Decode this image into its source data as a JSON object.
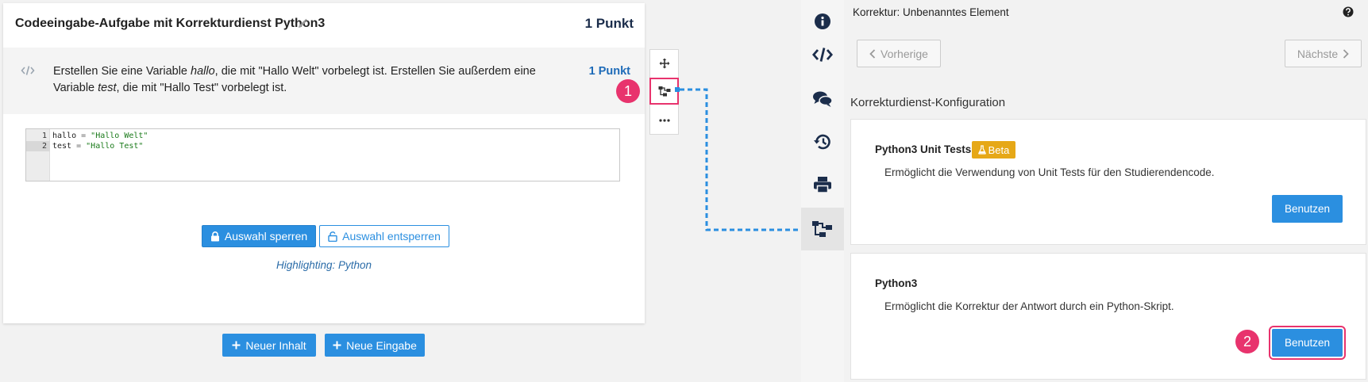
{
  "task": {
    "title": "Codeeingabe-Aufgabe mit Korrekturdienst Python3",
    "points": "1 Punkt",
    "question": {
      "text_1": "Erstellen Sie eine Variable ",
      "var_1": "hallo",
      "text_2": ", die mit \"Hallo Welt\" vorbelegt ist. Erstellen Sie außerdem eine Variable ",
      "var_2": "test",
      "text_3": ", die mit \"Hallo Test\" vorbelegt ist.",
      "points": "1 Punkt"
    },
    "editor": {
      "lines": [
        {
          "num": "1",
          "var": "hallo",
          "op": " = ",
          "str": "\"Hallo Welt\""
        },
        {
          "num": "2",
          "var": "test",
          "op": " = ",
          "str": "\"Hallo Test\""
        }
      ]
    },
    "lock_label": "Auswahl sperren",
    "unlock_label": "Auswahl entsperren",
    "highlighting": "Highlighting: Python"
  },
  "actions": {
    "new_content": "Neuer Inhalt",
    "new_input": "Neue Eingabe"
  },
  "annotations": {
    "badge_1": "1",
    "badge_2": "2"
  },
  "panel": {
    "title": "Korrektur: Unbenanntes Element",
    "prev_label": "Vorherige",
    "next_label": "Nächste",
    "section_title": "Korrekturdienst-Konfiguration",
    "services": [
      {
        "name": "Python3 Unit Tests",
        "badge": "Beta",
        "description": "Ermöglicht die Verwendung von Unit Tests für den Studierendencode.",
        "button": "Benutzen"
      },
      {
        "name": "Python3",
        "description": "Ermöglicht die Korrektur der Antwort durch ein Python-Skript.",
        "button": "Benutzen"
      }
    ]
  },
  "colors": {
    "accent": "#2b8fe0",
    "highlight": "#e8336d",
    "beta": "#e6a817",
    "title_dark": "#1b2d4b"
  }
}
